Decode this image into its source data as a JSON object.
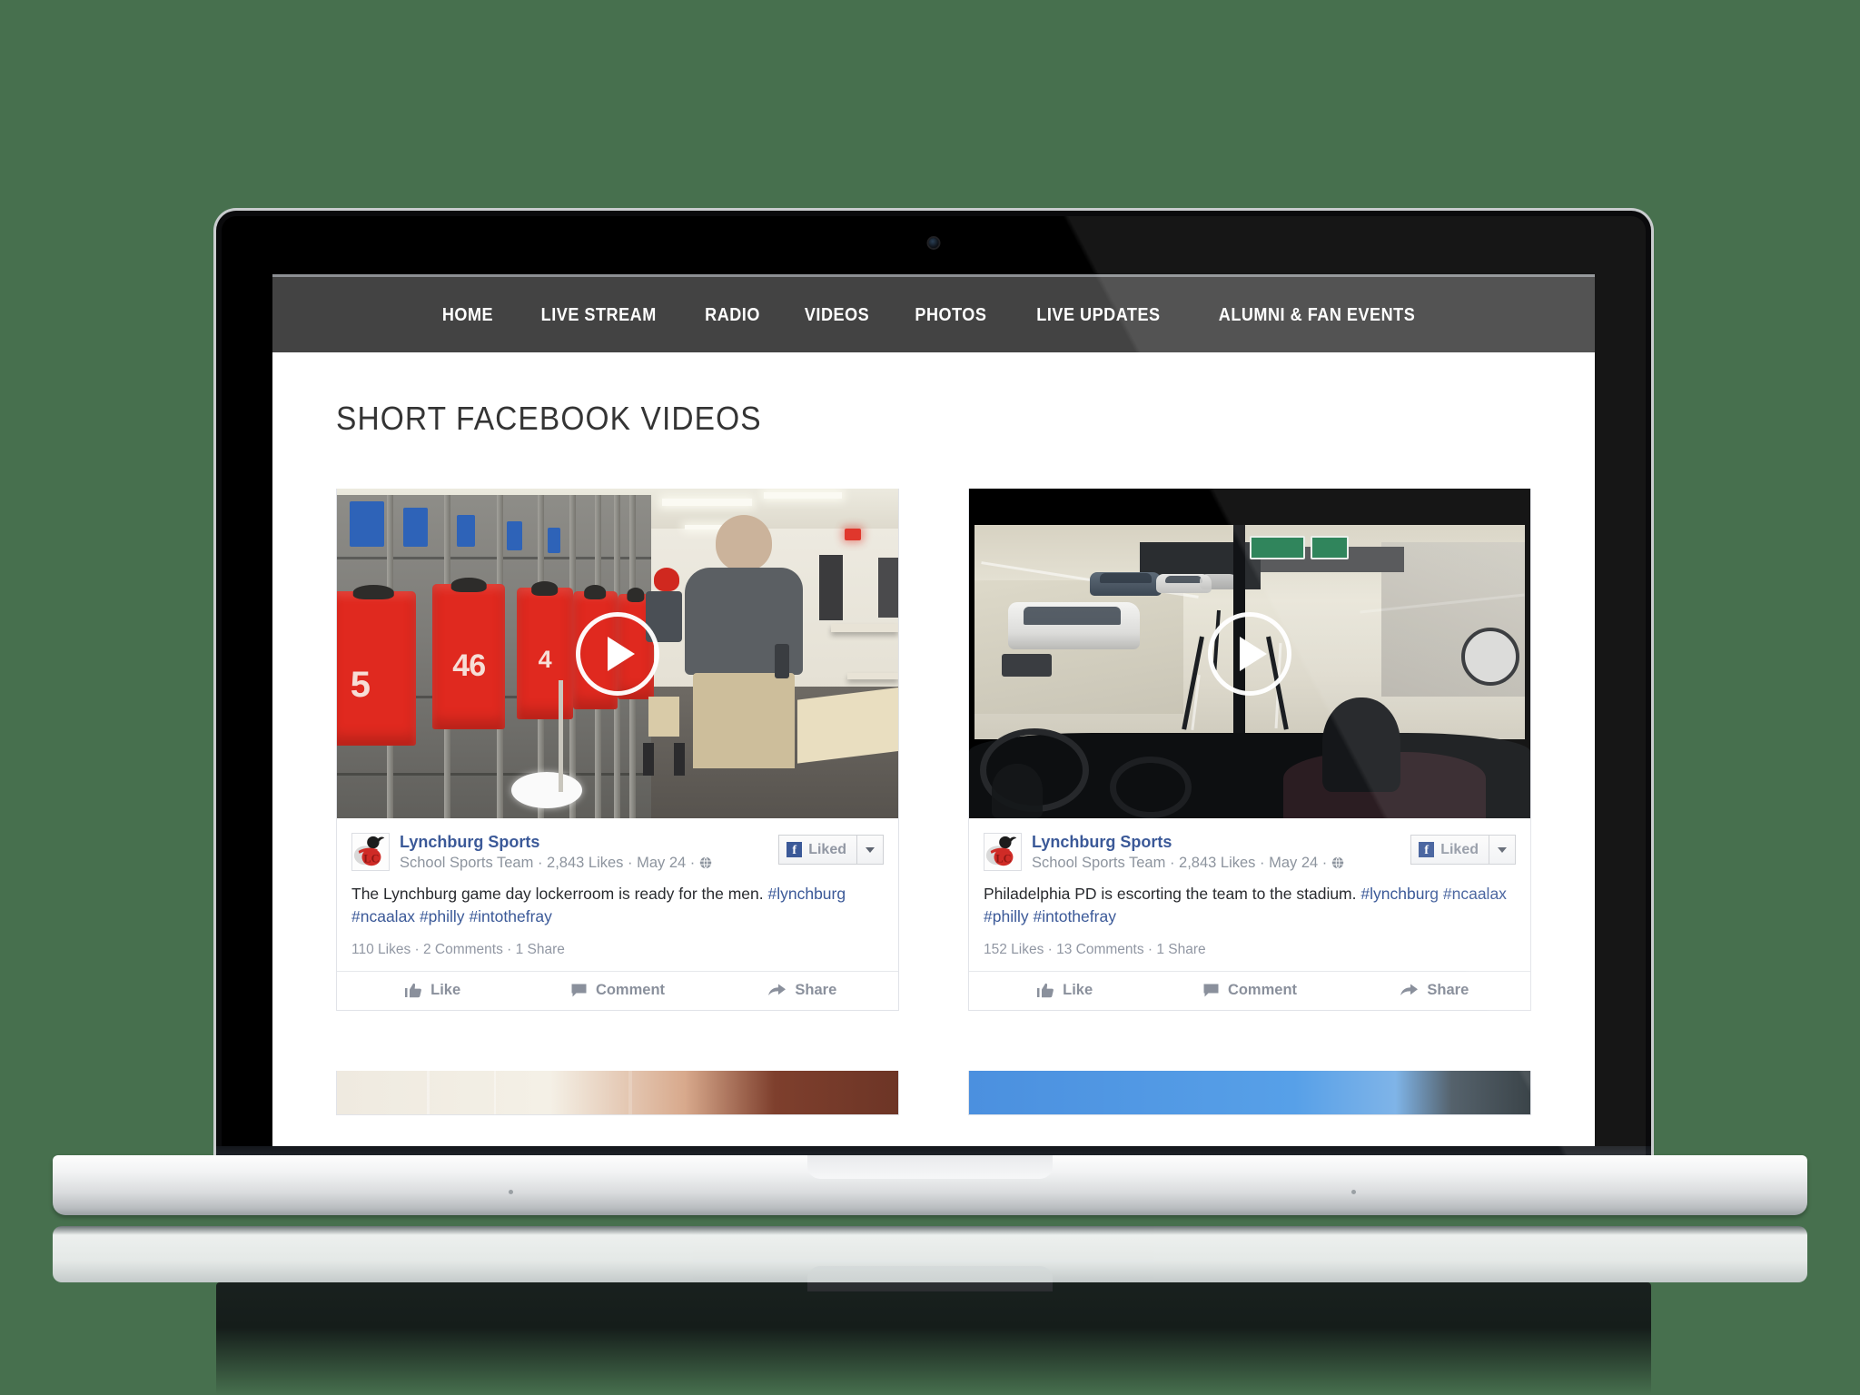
{
  "site": {
    "nav": [
      {
        "label": "Home"
      },
      {
        "label": "Live Stream"
      },
      {
        "label": "Radio"
      },
      {
        "label": "Videos"
      },
      {
        "label": "Photos"
      },
      {
        "label": "Live Updates"
      },
      {
        "label": "Alumni & Fan Events"
      }
    ],
    "page_title": "Short Facebook Videos",
    "colors": {
      "background": "#47704e",
      "nav_bar": "#434343",
      "nav_text": "#ffffff",
      "title_text": "#343434",
      "facebook_blue": "#3b5998",
      "meta_gray": "#8d949e"
    }
  },
  "posts": [
    {
      "page_name": "Lynchburg Sports",
      "meta": "School Sports Team · 2,843 Likes · May 24 ·",
      "privacy_icon": "globe-icon",
      "liked_button": {
        "label": "Liked",
        "icon": "facebook-f-icon",
        "caret": "chevron-down-icon"
      },
      "text": "The Lynchburg game day lockerroom is ready for the men.",
      "hashtags": [
        "#lynchburg",
        "#ncaalax",
        "#philly",
        "#intothefray"
      ],
      "stats": "110 Likes · 2 Comments · 1 Share",
      "actions": [
        {
          "label": "Like",
          "icon": "thumbs-up-icon"
        },
        {
          "label": "Comment",
          "icon": "comment-bubble-icon"
        },
        {
          "label": "Share",
          "icon": "share-arrow-icon"
        }
      ],
      "thumbnail": {
        "alt": "locker-room-with-red-jerseys",
        "play_icon": "play-button-icon"
      }
    },
    {
      "page_name": "Lynchburg Sports",
      "meta": "School Sports Team · 2,843 Likes · May 24 ·",
      "privacy_icon": "globe-icon",
      "liked_button": {
        "label": "Liked",
        "icon": "facebook-f-icon",
        "caret": "chevron-down-icon"
      },
      "text": "Philadelphia PD is escorting the team to the stadium.",
      "hashtags": [
        "#lynchburg",
        "#ncaalax",
        "#philly",
        "#intothefray"
      ],
      "stats": "152 Likes · 13 Comments · 1 Share",
      "actions": [
        {
          "label": "Like",
          "icon": "thumbs-up-icon"
        },
        {
          "label": "Comment",
          "icon": "comment-bubble-icon"
        },
        {
          "label": "Share",
          "icon": "share-arrow-icon"
        }
      ],
      "thumbnail": {
        "alt": "view-from-bus-on-highway",
        "play_icon": "play-button-icon"
      }
    }
  ],
  "partial_row": [
    {
      "thumbnail": {
        "alt": "indoor-cream-and-brick-scene"
      }
    },
    {
      "thumbnail": {
        "alt": "blue-sky-stadium-scene"
      }
    }
  ],
  "device": {
    "type": "laptop",
    "webcam": "webcam-dot"
  }
}
